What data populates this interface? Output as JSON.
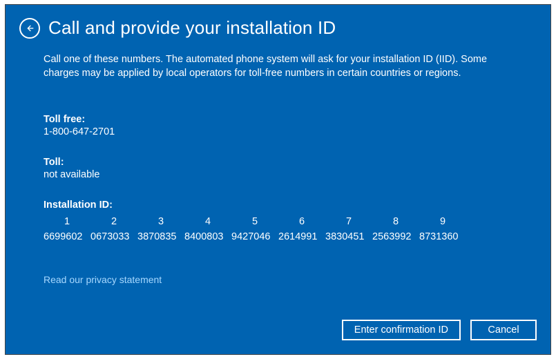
{
  "header": {
    "title": "Call and provide your installation ID"
  },
  "description": "Call one of these numbers. The automated phone system will ask for your installation ID (IID). Some charges may be applied by local operators for toll-free numbers in certain countries or regions.",
  "toll_free": {
    "label": "Toll free:",
    "value": "1-800-647-2701"
  },
  "toll": {
    "label": "Toll:",
    "value": "not available"
  },
  "installation_id": {
    "label": "Installation ID:",
    "columns": [
      "1",
      "2",
      "3",
      "4",
      "5",
      "6",
      "7",
      "8",
      "9"
    ],
    "values": [
      "6699602",
      "0673033",
      "3870835",
      "8400803",
      "9427046",
      "2614991",
      "3830451",
      "2563992",
      "8731360"
    ]
  },
  "privacy_link": "Read our privacy statement",
  "buttons": {
    "confirm": "Enter confirmation ID",
    "cancel": "Cancel"
  }
}
